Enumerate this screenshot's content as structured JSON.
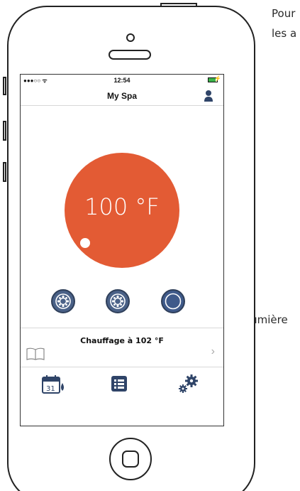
{
  "annotations": {
    "top_line1": "Pour",
    "top_line2": "les a",
    "light_label": "Lumière"
  },
  "status_bar": {
    "signal": "●●●○○ ᯤ",
    "time": "12:54",
    "battery_level": 0.8,
    "charging_icon": "bolt-icon"
  },
  "nav": {
    "title": "My Spa",
    "user_icon": "user-icon"
  },
  "temperature": {
    "display": "100 °F",
    "color": "#e35b34"
  },
  "controls": {
    "jet1_icon": "jet-icon",
    "jet2_icon": "jet-icon",
    "light_icon": "light-icon",
    "button_color": "#4a6187"
  },
  "heating": {
    "label": "Chauffage à 102 °F",
    "book_icon": "book-icon",
    "chevron": "›"
  },
  "tabs": {
    "calendar_day": "31",
    "items": [
      "calendar-icon",
      "list-icon",
      "settings-icon"
    ]
  }
}
